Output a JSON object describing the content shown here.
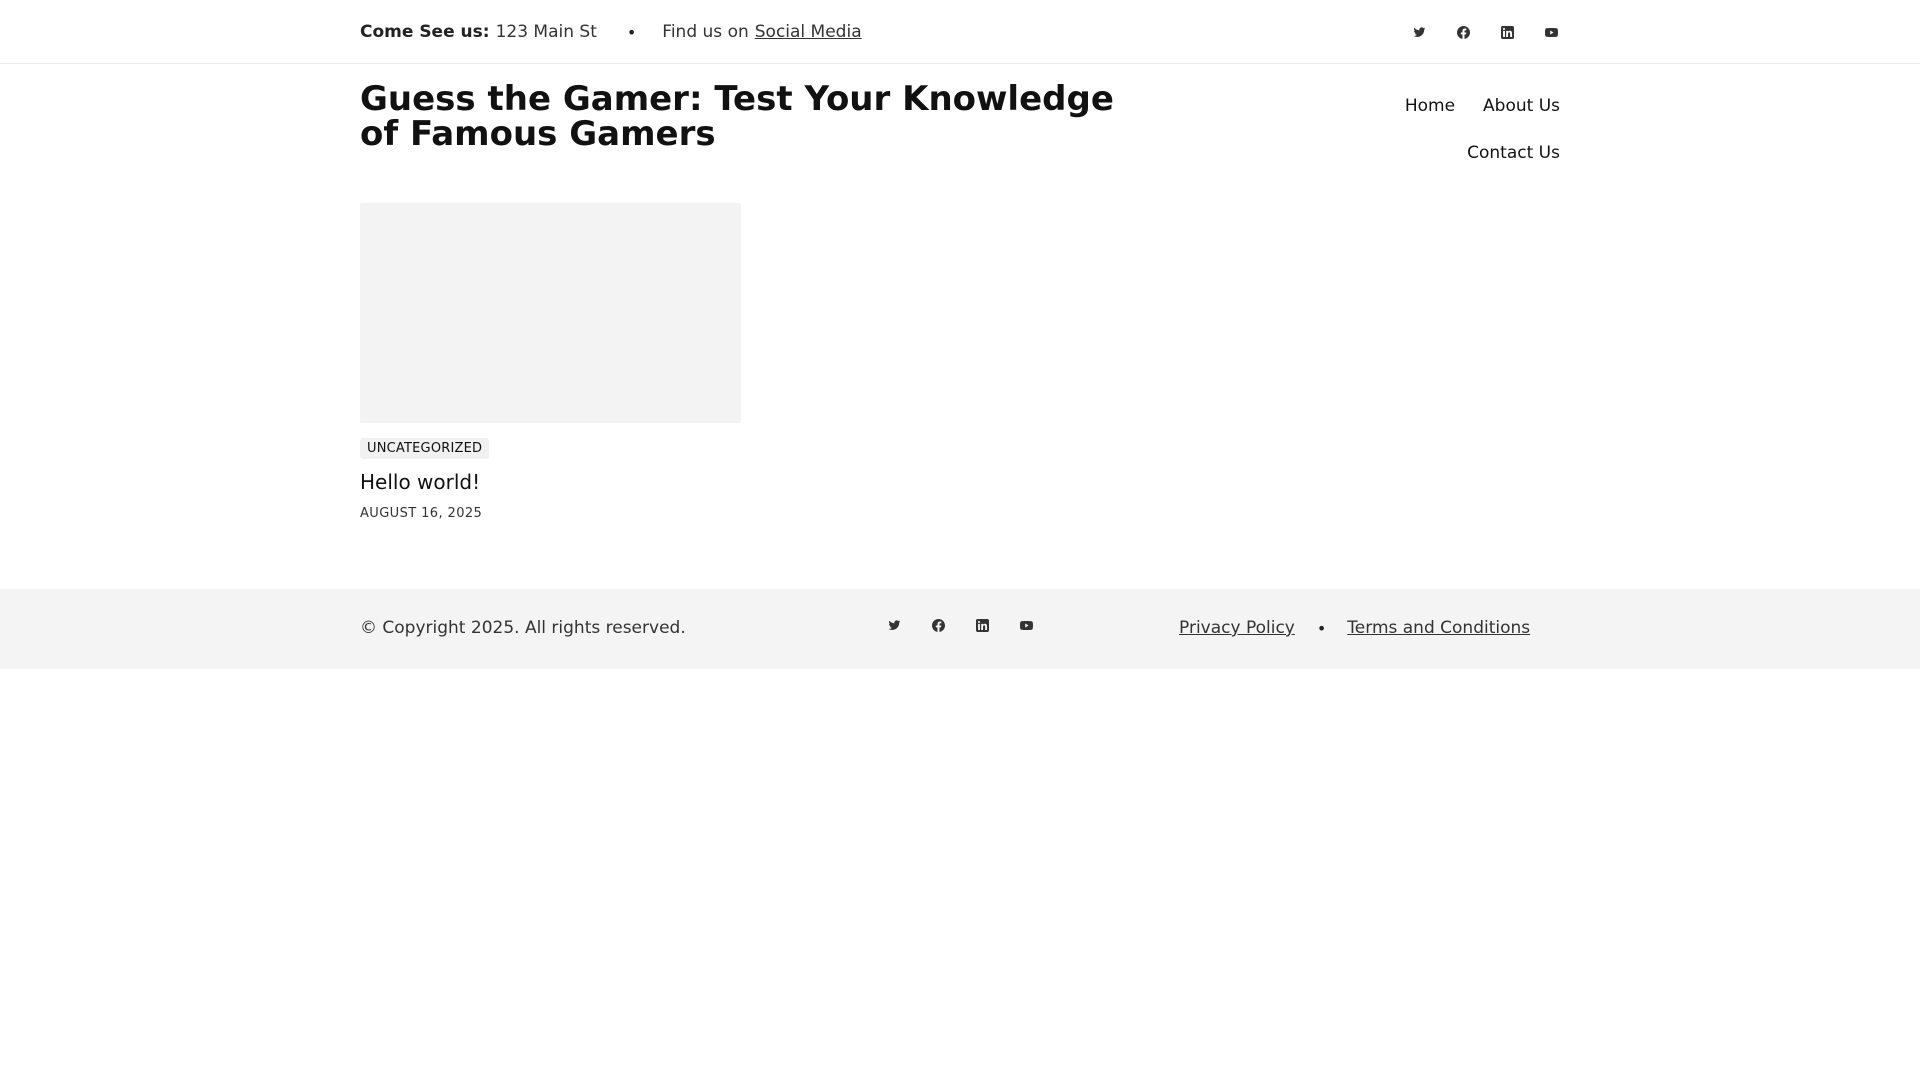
{
  "topbar": {
    "address_label": "Come See us:",
    "address_value": "123 Main St",
    "separator": "•",
    "social_prefix": "Find us on",
    "social_link": "Social Media",
    "icons": [
      "twitter-icon",
      "facebook-icon",
      "linkedin-icon",
      "youtube-icon"
    ]
  },
  "header": {
    "site_title": "Guess the Gamer: Test Your Knowledge of Famous Gamers",
    "nav": [
      {
        "label": "Home"
      },
      {
        "label": "About Us"
      },
      {
        "label": "Contact Us"
      }
    ]
  },
  "posts": [
    {
      "category": "UNCATEGORIZED",
      "title": "Hello world!",
      "date": "AUGUST 16, 2025"
    }
  ],
  "footer": {
    "copyright": "© Copyright 2025. All rights reserved.",
    "icons": [
      "twitter-icon",
      "facebook-icon",
      "linkedin-icon",
      "youtube-icon"
    ],
    "links": [
      {
        "label": "Privacy Policy"
      },
      {
        "label": "Terms and Conditions"
      }
    ],
    "separator": "•"
  }
}
